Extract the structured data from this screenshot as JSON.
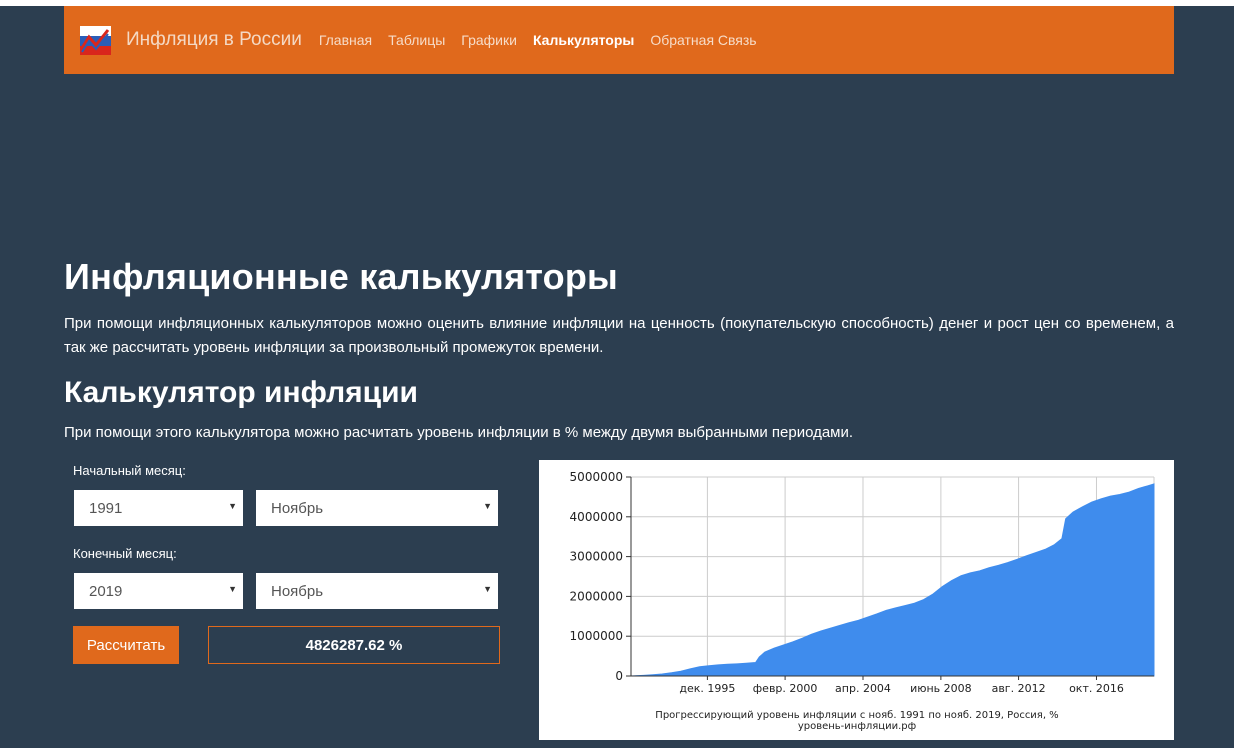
{
  "header": {
    "brand": "Инфляция в России",
    "nav": [
      "Главная",
      "Таблицы",
      "Графики",
      "Калькуляторы",
      "Обратная Связь"
    ],
    "active_index": 3
  },
  "main": {
    "title": "Инфляционные калькуляторы",
    "intro": "При помощи инфляционных калькуляторов можно оценить влияние инфляции на ценность (покупательскую способность) денег и рост цен со временем, а так же рассчитать уровень инфляции за произвольный промежуток времени.",
    "calc_title": "Калькулятор инфляции",
    "calc_desc": "При помощи этого калькулятора можно расчитать уровень инфляции в % между двумя выбранными периодами."
  },
  "form": {
    "start_label": "Начальный месяц:",
    "start_year": "1991",
    "start_month": "Ноябрь",
    "end_label": "Конечный месяц:",
    "end_year": "2019",
    "end_month": "Ноябрь",
    "button_label": "Рассчитать",
    "result": "4826287.62 %"
  },
  "colors": {
    "accent": "#e0691c",
    "background": "#2c3e50",
    "chart_fill": "#3f8ced"
  },
  "chart_data": {
    "type": "area",
    "title": "Прогрессирующий уровень инфляции с нояб. 1991 по нояб. 2019, Россия, %",
    "subtitle": "уровень-инфляции.рф",
    "ylim": [
      0,
      5000000
    ],
    "xlim": [
      1991.83,
      2019.83
    ],
    "yticks": [
      "0",
      "1000000",
      "2000000",
      "3000000",
      "4000000",
      "5000000"
    ],
    "ytick_values": [
      0,
      1000000,
      2000000,
      3000000,
      4000000,
      5000000
    ],
    "xtick_labels": [
      "дек. 1995",
      "февр. 2000",
      "апр. 2004",
      "июнь 2008",
      "авг. 2012",
      "окт. 2016"
    ],
    "xtick_values": [
      1995.92,
      2000.08,
      2004.25,
      2008.42,
      2012.58,
      2016.75
    ],
    "grid": true,
    "x": [
      1991.83,
      1992.5,
      1993.0,
      1993.5,
      1994.0,
      1994.5,
      1995.0,
      1995.5,
      1996.0,
      1996.5,
      1997.0,
      1997.5,
      1998.0,
      1998.5,
      1998.7,
      1999.0,
      1999.5,
      2000.0,
      2000.5,
      2001.0,
      2001.5,
      2002.0,
      2002.5,
      2003.0,
      2003.5,
      2004.0,
      2004.5,
      2005.0,
      2005.5,
      2006.0,
      2006.5,
      2007.0,
      2007.5,
      2008.0,
      2008.5,
      2009.0,
      2009.5,
      2010.0,
      2010.5,
      2011.0,
      2011.5,
      2012.0,
      2012.5,
      2013.0,
      2013.5,
      2014.0,
      2014.5,
      2014.9,
      2015.1,
      2015.5,
      2016.0,
      2016.5,
      2017.0,
      2017.5,
      2018.0,
      2018.5,
      2019.0,
      2019.5,
      2019.83
    ],
    "values": [
      0,
      15000,
      30000,
      50000,
      80000,
      120000,
      180000,
      230000,
      260000,
      280000,
      295000,
      305000,
      320000,
      340000,
      480000,
      600000,
      700000,
      780000,
      860000,
      950000,
      1050000,
      1130000,
      1200000,
      1270000,
      1340000,
      1400000,
      1480000,
      1560000,
      1650000,
      1710000,
      1770000,
      1830000,
      1920000,
      2060000,
      2250000,
      2400000,
      2520000,
      2590000,
      2640000,
      2720000,
      2780000,
      2850000,
      2930000,
      3020000,
      3100000,
      3180000,
      3300000,
      3450000,
      3950000,
      4120000,
      4250000,
      4370000,
      4450000,
      4520000,
      4560000,
      4620000,
      4710000,
      4780000,
      4826287.62
    ]
  }
}
